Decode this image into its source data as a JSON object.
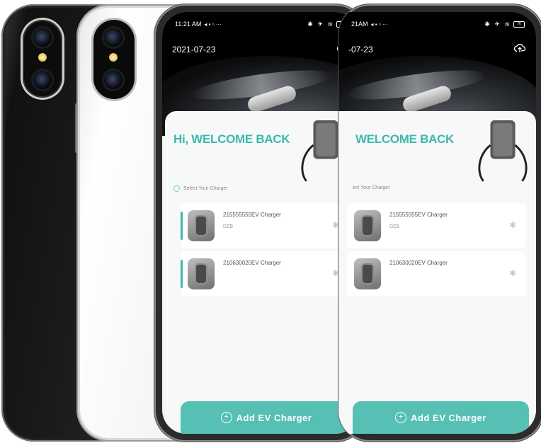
{
  "status_bar": {
    "time": "11:21 AM",
    "time_partial": "21AM",
    "icons": "✱ ✈ ≋",
    "battery": "76"
  },
  "header": {
    "date": "2021-07-23",
    "date_partial": "-07-23"
  },
  "welcome": {
    "title": "Hi, WELCOME BACK",
    "title_partial": "WELCOME BACK"
  },
  "select_label": "Select Your Charger",
  "select_label_partial": "ect Your Charger",
  "chargers": [
    {
      "name": "215555555EV Charger",
      "sub": "DZB"
    },
    {
      "name": "210630020EV Charger",
      "sub": ""
    }
  ],
  "add_button": {
    "label": "Add EV Charger"
  },
  "colors": {
    "accent": "#3bb8ae",
    "button": "#56c0b5"
  },
  "icons": [
    "cloud-upload-icon",
    "bluetooth-icon",
    "plus-circle-icon",
    "gear-icon"
  ]
}
